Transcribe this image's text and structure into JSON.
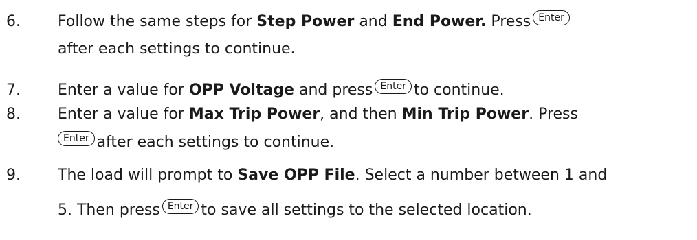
{
  "steps": [
    {
      "number": "6.",
      "line1": {
        "pre": "Follow the same steps for ",
        "b1": "Step Power",
        "mid": " and ",
        "b2": "End Power.",
        "post": " Press"
      },
      "line2": "after each settings to continue."
    },
    {
      "number": "7.",
      "pre": "Enter a value for ",
      "b1": "OPP Voltage",
      "mid": " and press",
      "post": "to continue."
    },
    {
      "number": "8.",
      "line1": {
        "pre": "Enter a value for ",
        "b1": "Max Trip Power",
        "mid": ", and then ",
        "b2": "Min Trip Power",
        "post": ".  Press"
      },
      "line2": "after each settings to continue."
    },
    {
      "number": "9.",
      "line1": {
        "pre": "The load will prompt to ",
        "b1": "Save OPP File",
        "post": ".  Select a number between 1 and"
      },
      "line2": {
        "pre": "5. Then press",
        "post": "to save all settings to the selected location."
      }
    }
  ],
  "key_label": "Enter"
}
